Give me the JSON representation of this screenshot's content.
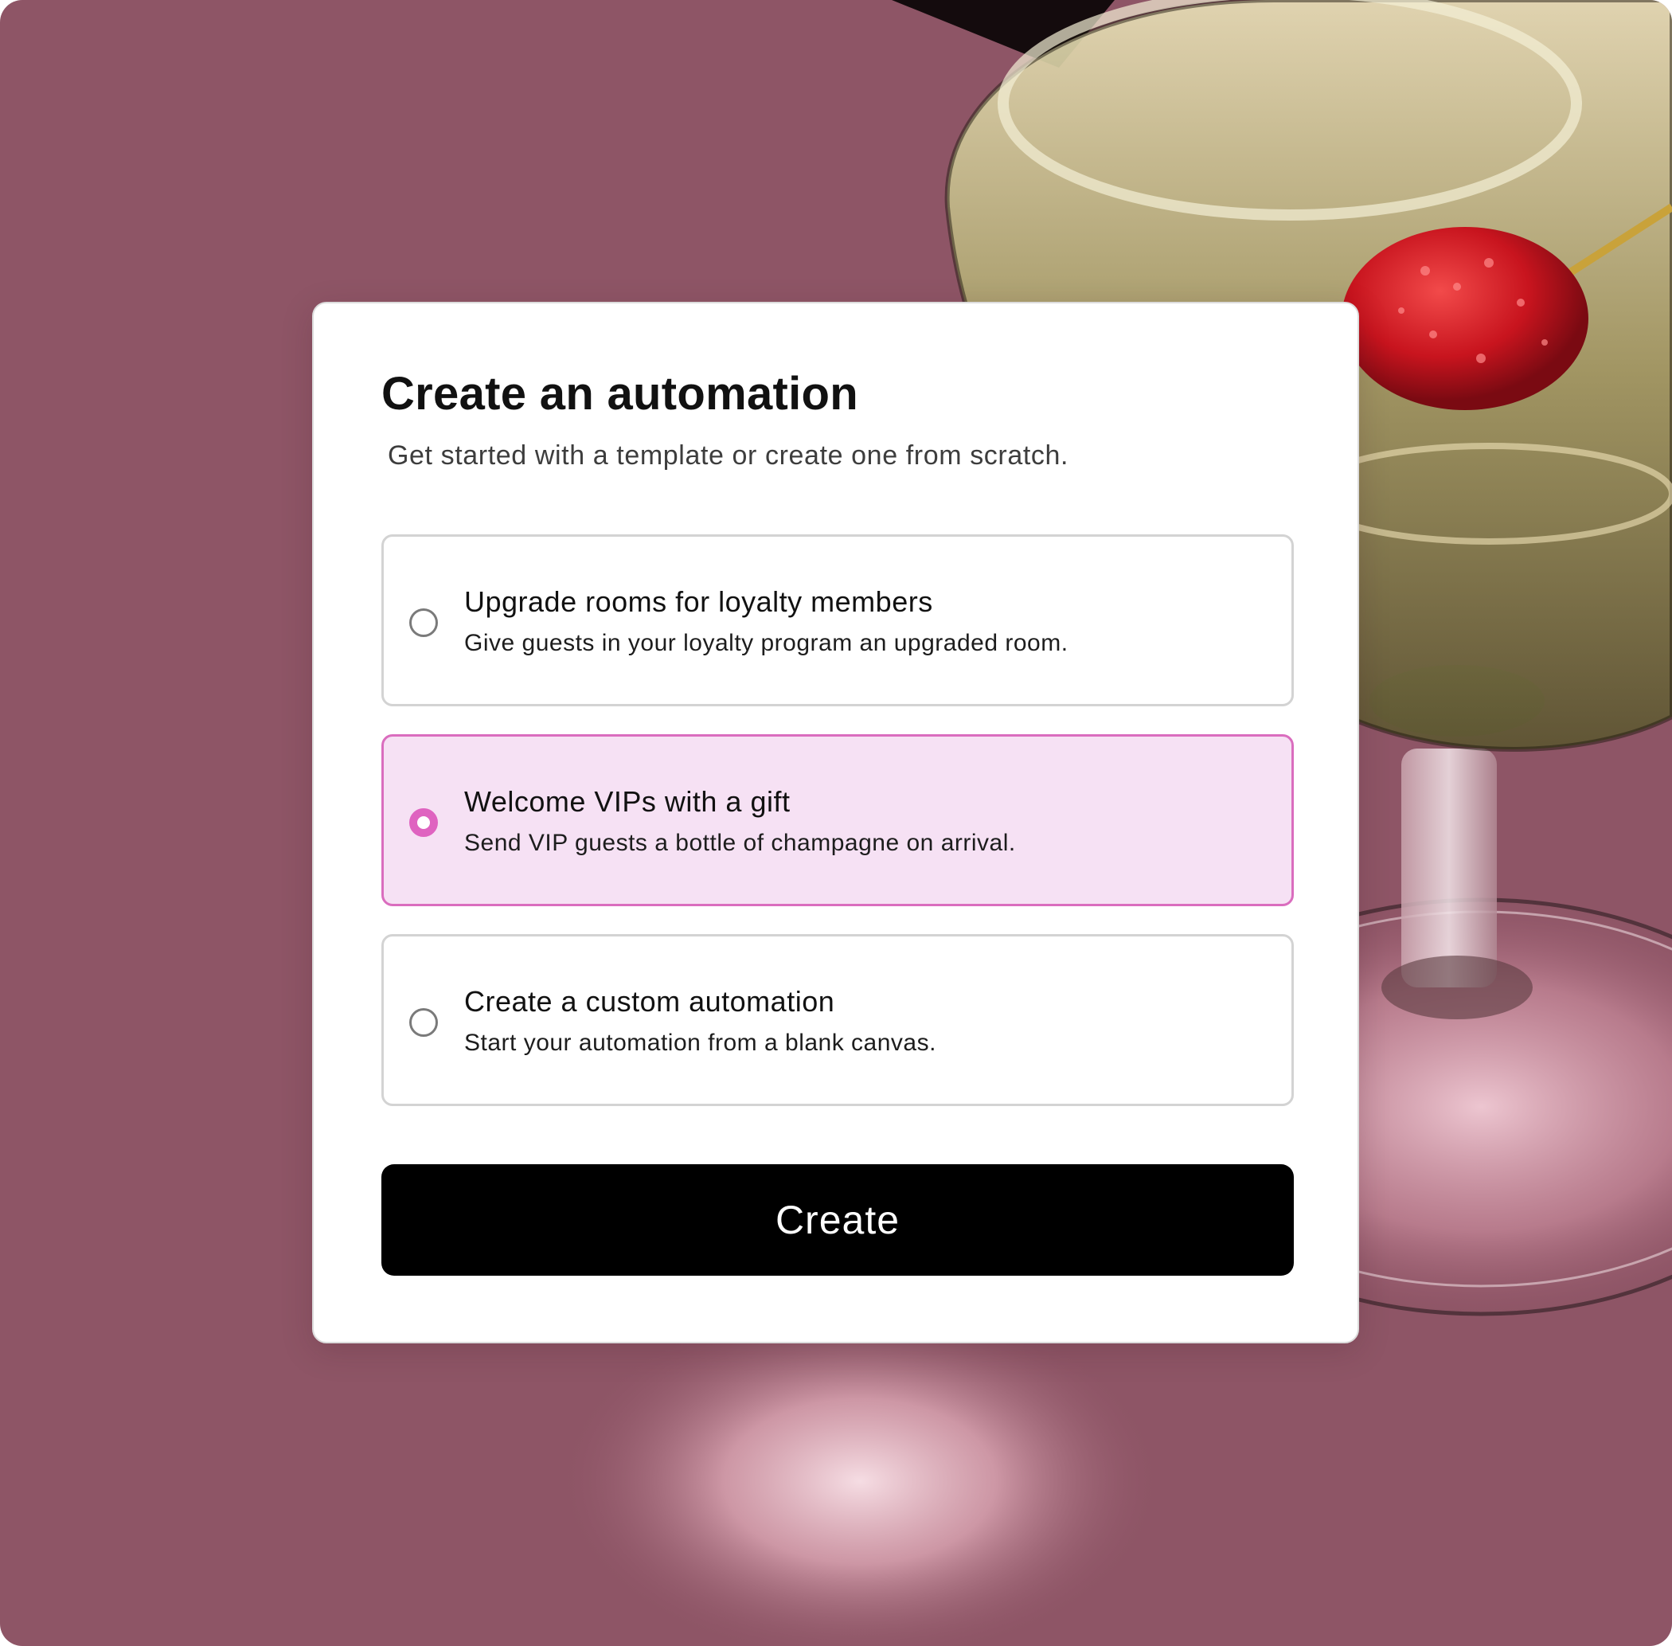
{
  "dialog": {
    "title": "Create an automation",
    "subtitle": "Get started with a template or create one from scratch."
  },
  "options": [
    {
      "title": "Upgrade rooms for loyalty members",
      "description": "Give guests in your loyalty program an upgraded room.",
      "selected": false
    },
    {
      "title": "Welcome VIPs with a gift",
      "description": "Send VIP guests a bottle of champagne on arrival.",
      "selected": true
    },
    {
      "title": "Create a custom automation",
      "description": "Start your automation from a blank canvas.",
      "selected": false
    }
  ],
  "actions": {
    "create_label": "Create"
  },
  "colors": {
    "background": "#8e5566",
    "accent": "#df63c0",
    "selected_fill": "#f6e1f4",
    "button": "#000000"
  }
}
